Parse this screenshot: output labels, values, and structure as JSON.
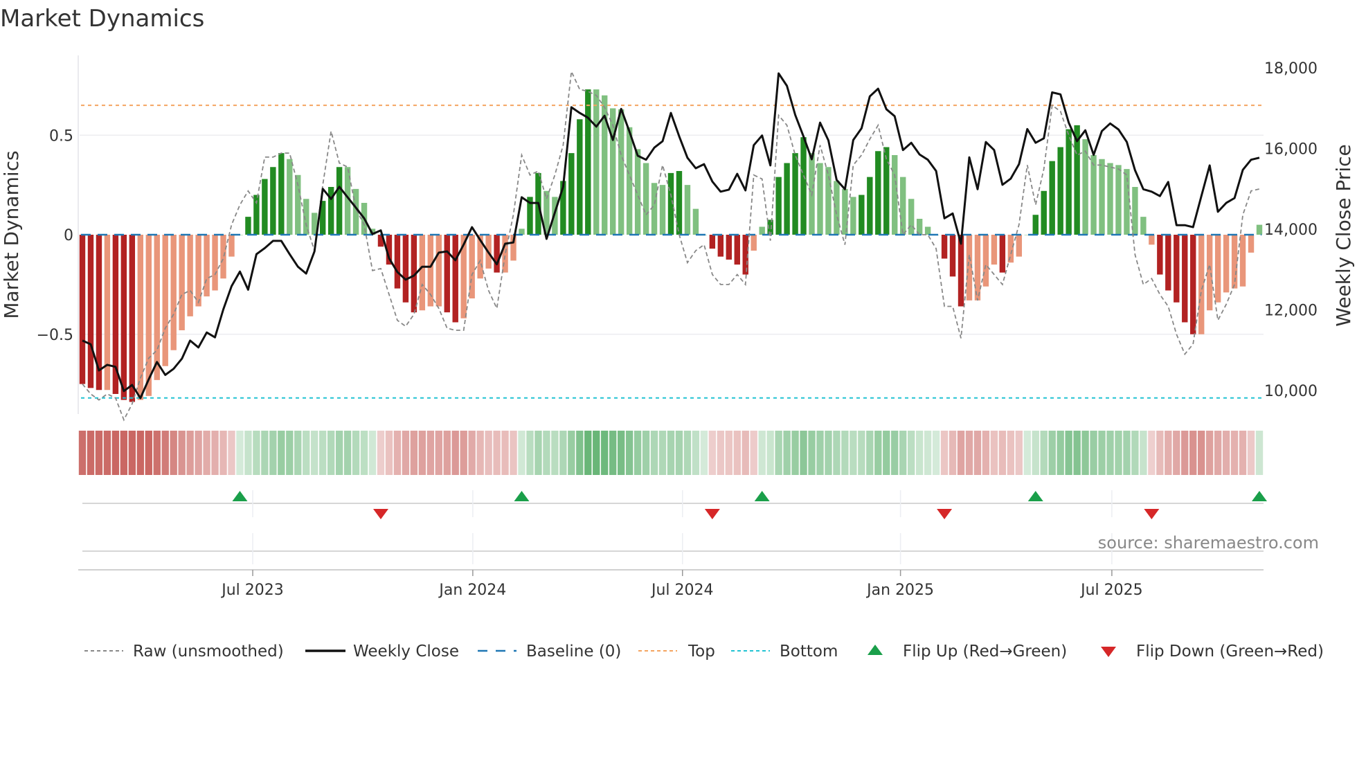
{
  "chart_data": {
    "type": "bar",
    "title": "Market Dynamics",
    "ylabel": "Market Dynamics",
    "y2label": "Weekly Close Price",
    "ylim": [
      -0.9,
      0.9
    ],
    "y2lim": [
      9500,
      18300
    ],
    "yticks": [
      {
        "v": 0.5,
        "label": "0.5"
      },
      {
        "v": 0,
        "label": "0"
      },
      {
        "v": -0.5,
        "label": "−0.5"
      }
    ],
    "y2ticks": [
      {
        "v": 18000,
        "label": "18,000"
      },
      {
        "v": 16000,
        "label": "16,000"
      },
      {
        "v": 14000,
        "label": "14,000"
      },
      {
        "v": 12000,
        "label": "12,000"
      },
      {
        "v": 10000,
        "label": "10,000"
      }
    ],
    "xticks": [
      {
        "week": 21.55,
        "label": "Jul 2023"
      },
      {
        "week": 48.1,
        "label": "Jan 2024"
      },
      {
        "week": 73.4,
        "label": "Jul 2024"
      },
      {
        "week": 99.7,
        "label": "Jan 2025"
      },
      {
        "week": 125.2,
        "label": "Jul 2025"
      }
    ],
    "levels": {
      "baseline": 0,
      "top": 0.65,
      "bottom": -0.82
    },
    "source": "source: sharemaestro.com",
    "colors": {
      "strong_neg": "#b22222",
      "weak_neg": "#e9967a",
      "strong_pos": "#228b22",
      "weak_pos": "#80c080",
      "baseline": "#1f77b4",
      "top": "#f4a460",
      "bottom": "#22c3d3",
      "flip_up": "#1a9f4a",
      "flip_down": "#d62728",
      "close": "#111111",
      "raw": "#888888"
    },
    "series": [
      {
        "name": "Market Dynamics",
        "axis": "left",
        "values": [
          -0.75,
          -0.77,
          -0.78,
          -0.78,
          -0.8,
          -0.83,
          -0.84,
          -0.83,
          -0.81,
          -0.73,
          -0.66,
          -0.58,
          -0.48,
          -0.41,
          -0.36,
          -0.31,
          -0.28,
          -0.22,
          -0.11,
          0.0,
          0.09,
          0.2,
          0.28,
          0.34,
          0.41,
          0.38,
          0.3,
          0.18,
          0.11,
          0.17,
          0.24,
          0.34,
          0.34,
          0.23,
          0.16,
          0.03,
          -0.06,
          -0.15,
          -0.27,
          -0.34,
          -0.39,
          -0.38,
          -0.36,
          -0.36,
          -0.39,
          -0.44,
          -0.42,
          -0.32,
          -0.22,
          -0.17,
          -0.19,
          -0.19,
          -0.13,
          0.03,
          0.19,
          0.31,
          0.22,
          0.19,
          0.27,
          0.41,
          0.58,
          0.73,
          0.73,
          0.7,
          0.635,
          0.63,
          0.54,
          0.43,
          0.36,
          0.26,
          0.25,
          0.31,
          0.32,
          0.25,
          0.13,
          0.0,
          -0.07,
          -0.11,
          -0.125,
          -0.15,
          -0.2,
          -0.08,
          0.04,
          0.075,
          0.29,
          0.36,
          0.41,
          0.49,
          0.41,
          0.36,
          0.34,
          0.27,
          0.23,
          0.19,
          0.2,
          0.29,
          0.42,
          0.44,
          0.4,
          0.29,
          0.18,
          0.08,
          0.04,
          0.0,
          -0.12,
          -0.21,
          -0.36,
          -0.33,
          -0.33,
          -0.26,
          -0.15,
          -0.19,
          -0.14,
          -0.11,
          0.0,
          0.1,
          0.22,
          0.37,
          0.44,
          0.53,
          0.55,
          0.48,
          0.4,
          0.38,
          0.36,
          0.35,
          0.33,
          0.24,
          0.09,
          -0.05,
          -0.2,
          -0.28,
          -0.34,
          -0.44,
          -0.5,
          -0.5,
          -0.38,
          -0.34,
          -0.29,
          -0.27,
          -0.26,
          -0.09,
          0.05
        ]
      },
      {
        "name": "Raw (unsmoothed)",
        "axis": "left",
        "values": [
          -0.75,
          -0.8,
          -0.83,
          -0.8,
          -0.82,
          -0.93,
          -0.85,
          -0.72,
          -0.62,
          -0.58,
          -0.47,
          -0.4,
          -0.3,
          -0.28,
          -0.34,
          -0.22,
          -0.2,
          -0.12,
          0.05,
          0.15,
          0.22,
          0.16,
          0.39,
          0.39,
          0.41,
          0.41,
          0.25,
          0.05,
          -0.08,
          0.25,
          0.52,
          0.36,
          0.34,
          0.13,
          0.05,
          -0.18,
          -0.17,
          -0.3,
          -0.43,
          -0.46,
          -0.4,
          -0.25,
          -0.3,
          -0.37,
          -0.47,
          -0.48,
          -0.48,
          -0.2,
          -0.13,
          -0.28,
          -0.37,
          -0.1,
          0.1,
          0.4,
          0.3,
          0.32,
          0.18,
          0.3,
          0.45,
          0.82,
          0.73,
          0.72,
          0.7,
          0.64,
          0.55,
          0.4,
          0.3,
          0.2,
          0.1,
          0.15,
          0.35,
          0.2,
          0.0,
          -0.14,
          -0.08,
          -0.05,
          -0.2,
          -0.25,
          -0.25,
          -0.2,
          -0.25,
          0.3,
          0.28,
          -0.03,
          0.6,
          0.55,
          0.4,
          0.3,
          0.2,
          0.45,
          0.3,
          0.1,
          -0.05,
          0.35,
          0.4,
          0.48,
          0.55,
          0.38,
          0.3,
          0.0,
          0.05,
          0.0,
          0.0,
          -0.07,
          -0.36,
          -0.36,
          -0.52,
          -0.1,
          -0.33,
          -0.15,
          -0.2,
          -0.25,
          -0.1,
          0.05,
          0.35,
          0.15,
          0.33,
          0.65,
          0.62,
          0.5,
          0.4,
          0.42,
          0.35,
          0.35,
          0.34,
          0.33,
          0.3,
          -0.1,
          -0.25,
          -0.22,
          -0.3,
          -0.36,
          -0.5,
          -0.6,
          -0.55,
          -0.28,
          -0.15,
          -0.43,
          -0.35,
          -0.25,
          0.1,
          0.22,
          0.23
        ]
      },
      {
        "name": "Weekly Close",
        "axis": "right",
        "values": [
          11240,
          11150,
          10500,
          10640,
          10590,
          9990,
          10140,
          9815,
          10280,
          10710,
          10390,
          10540,
          10790,
          11240,
          11070,
          11440,
          11320,
          12010,
          12590,
          12950,
          12500,
          13380,
          13530,
          13710,
          13710,
          13380,
          13070,
          12900,
          13450,
          15000,
          14750,
          15050,
          14790,
          14530,
          14270,
          13880,
          13970,
          13280,
          12940,
          12750,
          12850,
          13070,
          13070,
          13420,
          13450,
          13230,
          13620,
          14050,
          13730,
          13420,
          13130,
          13640,
          13670,
          14790,
          14650,
          14650,
          13760,
          14410,
          15050,
          17020,
          16880,
          16760,
          16540,
          16810,
          16210,
          16980,
          16420,
          15820,
          15720,
          16020,
          16180,
          16880,
          16300,
          15770,
          15510,
          15610,
          15180,
          14930,
          14980,
          15370,
          14960,
          16080,
          16320,
          15580,
          17860,
          17550,
          16830,
          16300,
          15730,
          16640,
          16200,
          15220,
          14990,
          16210,
          16500,
          17290,
          17480,
          16970,
          16800,
          15960,
          16140,
          15850,
          15720,
          15440,
          14270,
          14390,
          13640,
          15780,
          14990,
          16160,
          15960,
          15100,
          15250,
          15610,
          16480,
          16140,
          16250,
          17390,
          17340,
          16640,
          16180,
          16450,
          15840,
          16430,
          16620,
          16470,
          16160,
          15460,
          14990,
          14930,
          14820,
          15170,
          14100,
          14100,
          14050,
          14820,
          15580,
          14430,
          14650,
          14770,
          15470,
          15720,
          15770
        ]
      }
    ],
    "flips": {
      "up_weeks": [
        20,
        54,
        83,
        116,
        143
      ],
      "down_weeks": [
        37,
        77,
        105,
        130
      ]
    },
    "legend": {
      "placement": "bottom",
      "items": [
        {
          "key": "raw",
          "label": "Raw (unsmoothed)"
        },
        {
          "key": "close",
          "label": "Weekly Close"
        },
        {
          "key": "baseline",
          "label": "Baseline (0)"
        },
        {
          "key": "top",
          "label": "Top"
        },
        {
          "key": "bottom",
          "label": "Bottom"
        },
        {
          "key": "flip_up",
          "label": "Flip Up (Red→Green)"
        },
        {
          "key": "flip_down",
          "label": "Flip Down (Green→Red)"
        }
      ]
    }
  }
}
